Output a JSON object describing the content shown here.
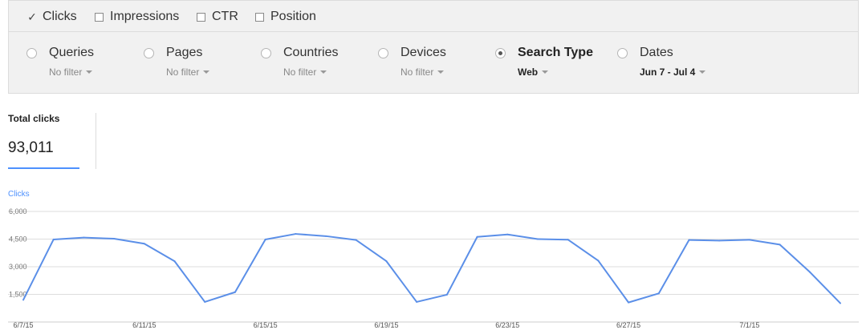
{
  "metrics": [
    {
      "label": "Clicks",
      "checked": true
    },
    {
      "label": "Impressions",
      "checked": false
    },
    {
      "label": "CTR",
      "checked": false
    },
    {
      "label": "Position",
      "checked": false
    }
  ],
  "filters": [
    {
      "label": "Queries",
      "value": "No filter",
      "selected": false
    },
    {
      "label": "Pages",
      "value": "No filter",
      "selected": false
    },
    {
      "label": "Countries",
      "value": "No filter",
      "selected": false
    },
    {
      "label": "Devices",
      "value": "No filter",
      "selected": false
    },
    {
      "label": "Search Type",
      "value": "Web",
      "selected": true
    },
    {
      "label": "Dates",
      "value": "Jun 7 - Jul 4",
      "selected": false
    }
  ],
  "totals": {
    "label": "Total clicks",
    "value": "93,011"
  },
  "colors": {
    "accent": "#4d90fe",
    "line": "#5b8fe8",
    "background": "#f1f1f1"
  },
  "chart_data": {
    "type": "line",
    "series": [
      {
        "name": "Clicks",
        "values": [
          1200,
          4480,
          4580,
          4520,
          4250,
          3300,
          1090,
          1620,
          4480,
          4780,
          4660,
          4450,
          3300,
          1090,
          1480,
          4620,
          4750,
          4500,
          4470,
          3330,
          1060,
          1550,
          4450,
          4420,
          4460,
          4200,
          2700,
          1020
        ]
      }
    ],
    "x": [
      "6/7/15",
      "6/8/15",
      "6/9/15",
      "6/10/15",
      "6/11/15",
      "6/12/15",
      "6/13/15",
      "6/14/15",
      "6/15/15",
      "6/16/15",
      "6/17/15",
      "6/18/15",
      "6/19/15",
      "6/20/15",
      "6/21/15",
      "6/22/15",
      "6/23/15",
      "6/24/15",
      "6/25/15",
      "6/26/15",
      "6/27/15",
      "6/28/15",
      "6/29/15",
      "6/30/15",
      "7/1/15",
      "7/2/15",
      "7/3/15",
      "7/4/15"
    ],
    "xtick_labels": [
      "6/7/15",
      "6/11/15",
      "6/15/15",
      "6/19/15",
      "6/23/15",
      "6/27/15",
      "7/1/15"
    ],
    "yticks": [
      "1,500",
      "3,000",
      "4,500",
      "6,000"
    ],
    "ytick_values": [
      1500,
      3000,
      4500,
      6000
    ],
    "ylim": [
      0,
      6000
    ],
    "ylabel": "Clicks",
    "grid": true
  }
}
